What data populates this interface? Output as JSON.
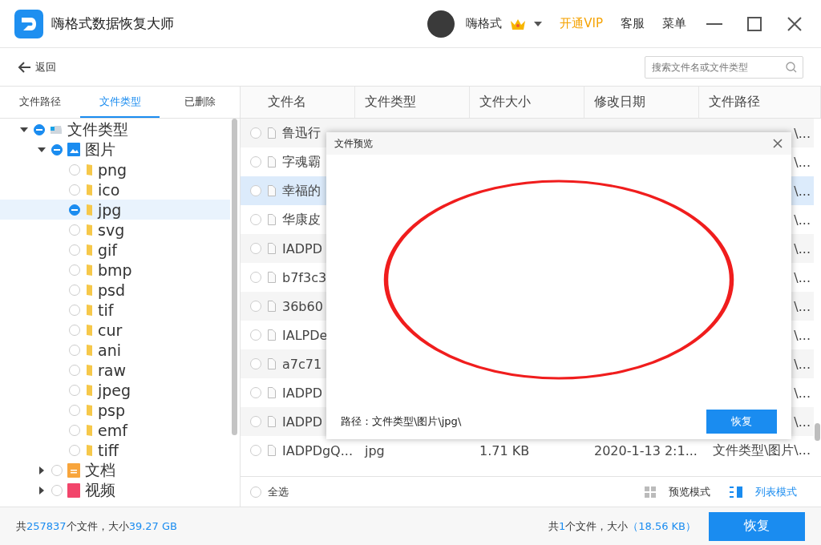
{
  "app": {
    "title": "嗨格式数据恢复大师",
    "user": "嗨格式",
    "vip": "开通VIP",
    "service": "客服",
    "menu": "菜单"
  },
  "toolbar": {
    "back": "返回",
    "search": {
      "placeholder": "搜索文件名或文件类型"
    }
  },
  "sidebar": {
    "tabs": [
      {
        "label": "文件路径",
        "selected": false
      },
      {
        "label": "文件类型",
        "selected": true
      },
      {
        "label": "已删除",
        "selected": false
      }
    ],
    "tree": [
      {
        "label": "文件类型",
        "kind": "drive",
        "expanded": true,
        "checked": true,
        "selected": false,
        "children": [
          {
            "label": "图片",
            "kind": "image",
            "expanded": true,
            "checked": true,
            "selected": false,
            "children": [
              {
                "label": "png",
                "kind": "folder",
                "checked": false,
                "selected": false
              },
              {
                "label": "ico",
                "kind": "folder",
                "checked": false,
                "selected": false
              },
              {
                "label": "jpg",
                "kind": "folder",
                "checked": true,
                "selected": true
              },
              {
                "label": "svg",
                "kind": "folder",
                "checked": false,
                "selected": false
              },
              {
                "label": "gif",
                "kind": "folder",
                "checked": false,
                "selected": false
              },
              {
                "label": "bmp",
                "kind": "folder",
                "checked": false,
                "selected": false
              },
              {
                "label": "psd",
                "kind": "folder",
                "checked": false,
                "selected": false
              },
              {
                "label": "tif",
                "kind": "folder",
                "checked": false,
                "selected": false
              },
              {
                "label": "cur",
                "kind": "folder",
                "checked": false,
                "selected": false
              },
              {
                "label": "ani",
                "kind": "folder",
                "checked": false,
                "selected": false
              },
              {
                "label": "raw",
                "kind": "folder",
                "checked": false,
                "selected": false
              },
              {
                "label": "jpeg",
                "kind": "folder",
                "checked": false,
                "selected": false
              },
              {
                "label": "psp",
                "kind": "folder",
                "checked": false,
                "selected": false
              },
              {
                "label": "emf",
                "kind": "folder",
                "checked": false,
                "selected": false
              },
              {
                "label": "tiff",
                "kind": "folder",
                "checked": false,
                "selected": false
              }
            ]
          },
          {
            "label": "文档",
            "kind": "document",
            "expanded": false,
            "checked": false,
            "selected": false
          },
          {
            "label": "视频",
            "kind": "video",
            "expanded": false,
            "checked": false,
            "selected": false
          }
        ]
      }
    ]
  },
  "table": {
    "columns": [
      "文件名",
      "文件类型",
      "文件大小",
      "修改日期",
      "文件路径"
    ],
    "rows": [
      {
        "name": "鲁迅行",
        "path": "\\...",
        "selected": false
      },
      {
        "name": "字魂霸",
        "path": "\\...",
        "selected": false
      },
      {
        "name": "幸福的",
        "path": "\\...",
        "selected": true
      },
      {
        "name": "华康皮",
        "path": "\\...",
        "selected": false
      },
      {
        "name": "IADPD",
        "path": "\\...",
        "selected": false
      },
      {
        "name": "b7f3c3",
        "path": "\\...",
        "selected": false
      },
      {
        "name": "36b60",
        "path": "\\...",
        "selected": false
      },
      {
        "name": "IALPDe",
        "path": "\\...",
        "selected": false
      },
      {
        "name": "a7c71",
        "path": "\\...",
        "selected": false
      },
      {
        "name": "IADPD",
        "path": "\\...",
        "selected": false
      },
      {
        "name": "IADPD",
        "path": "\\...",
        "selected": false
      },
      {
        "name": "IADPDgQ...",
        "type": "jpg",
        "size": "1.71 KB",
        "date": "2020-1-13 2:1...",
        "path": "文件类型\\图片\\...",
        "selected": false
      }
    ],
    "select_all": {
      "label": "全选",
      "checked": false
    },
    "views": [
      {
        "label": "预览模式",
        "kind": "grid",
        "selected": false
      },
      {
        "label": "列表模式",
        "kind": "list",
        "selected": true
      }
    ]
  },
  "preview": {
    "title": "文件预览",
    "path": "路径：文件类型\\图片\\jpg\\",
    "button": "恢复"
  },
  "footer": {
    "total": [
      {
        "text": "共",
        "highlight": false
      },
      {
        "text": "257837",
        "highlight": true
      },
      {
        "text": "个文件，大小",
        "highlight": false
      },
      {
        "text": "39.27 GB",
        "highlight": true
      }
    ],
    "selected": [
      {
        "text": "共",
        "highlight": false
      },
      {
        "text": "1",
        "highlight": true
      },
      {
        "text": "个文件，大小",
        "highlight": false
      },
      {
        "text": "（18.56 KB）",
        "highlight": true
      }
    ],
    "button": "恢复"
  }
}
